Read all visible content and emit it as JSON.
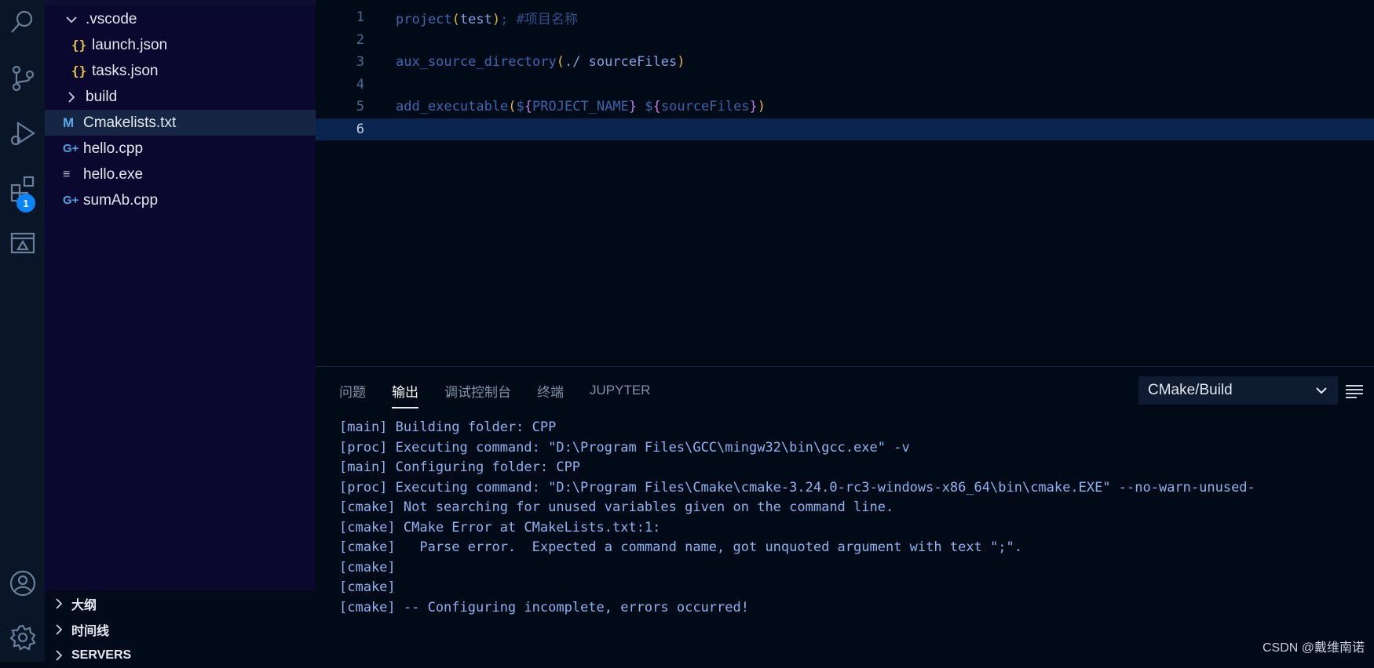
{
  "activity_bar": {
    "icons": [
      "search-icon",
      "source-control-icon",
      "run-debug-icon",
      "extensions-icon",
      "remote-explorer-icon",
      "account-icon",
      "settings-icon"
    ],
    "extensions_badge": "1"
  },
  "explorer": {
    "items": [
      {
        "label": ".vscode",
        "type": "folder-open"
      },
      {
        "label": "launch.json",
        "type": "json",
        "icon": "{}"
      },
      {
        "label": "tasks.json",
        "type": "json",
        "icon": "{}"
      },
      {
        "label": "build",
        "type": "folder-closed"
      },
      {
        "label": "Cmakelists.txt",
        "type": "cmake",
        "icon": "M"
      },
      {
        "label": "hello.cpp",
        "type": "cpp",
        "icon": "G+"
      },
      {
        "label": "hello.exe",
        "type": "exe",
        "icon": "≡"
      },
      {
        "label": "sumAb.cpp",
        "type": "cpp",
        "icon": "G+"
      }
    ],
    "selected": "Cmakelists.txt",
    "sections": [
      "大纲",
      "时间线",
      "SERVERS"
    ]
  },
  "editor": {
    "line_numbers": [
      "1",
      "2",
      "3",
      "4",
      "5",
      "6"
    ],
    "current_line": "6",
    "line1": {
      "fn": "project",
      "open": "(",
      "arg": "test",
      "close": ")",
      "rest": "; #项目名称"
    },
    "line3": {
      "fn": "aux_source_directory",
      "open": "(",
      "arg": "./ sourceFiles",
      "close": ")"
    },
    "line5": {
      "fn": "add_executable",
      "open": "(",
      "dollar1": "$",
      "lb1": "{",
      "var1": "PROJECT_NAME",
      "rb1": "}",
      "dollar2": " $",
      "lb2": "{",
      "var2": "sourceFiles",
      "rb2": "}",
      "close": ")"
    }
  },
  "panel": {
    "tabs": [
      "问题",
      "输出",
      "调试控制台",
      "终端",
      "JUPYTER"
    ],
    "active_tab": "输出",
    "channel": "CMake/Build",
    "output": [
      "[main] Building folder: CPP",
      "[proc] Executing command: \"D:\\Program Files\\GCC\\mingw32\\bin\\gcc.exe\" -v",
      "[main] Configuring folder: CPP",
      "[proc] Executing command: \"D:\\Program Files\\Cmake\\cmake-3.24.0-rc3-windows-x86_64\\bin\\cmake.EXE\" --no-warn-unused-",
      "[cmake] Not searching for unused variables given on the command line.",
      "[cmake] CMake Error at CMakeLists.txt:1:",
      "[cmake]   Parse error.  Expected a command name, got unquoted argument with text \";\".",
      "[cmake]",
      "[cmake]",
      "[cmake] -- Configuring incomplete, errors occurred!"
    ]
  },
  "watermark": "CSDN @戴维南诺"
}
